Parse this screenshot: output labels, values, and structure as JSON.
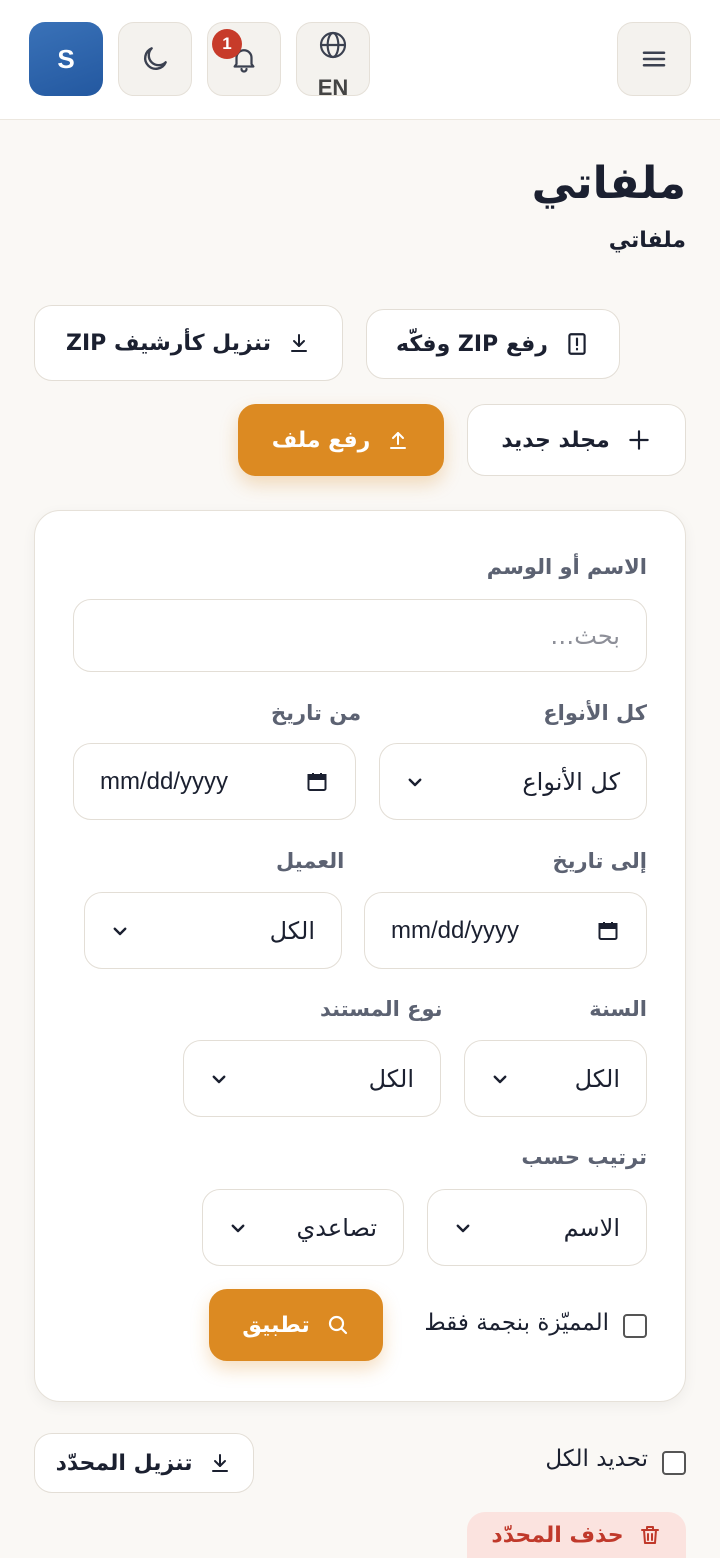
{
  "header": {
    "avatar_initial": "S",
    "notification_count": "1",
    "language_label": "EN",
    "icons": [
      "menu-icon",
      "globe-icon",
      "bell-icon",
      "moon-icon"
    ]
  },
  "page": {
    "title": "ملفاتي",
    "subtitle": "ملفاتي"
  },
  "actions": {
    "download_zip": "تنزيل كأرشيف ZIP",
    "upload_zip": "رفع ZIP وفكّه",
    "new_folder": "مجلد جديد",
    "upload_file": "رفع ملف"
  },
  "filters": {
    "search_label": "الاسم أو الوسم",
    "search_placeholder": "بحث…",
    "type_label": "كل الأنواع",
    "type_value": "كل الأنواع",
    "from_date_label": "من تاريخ",
    "from_date_value": "mm/dd/yyyy",
    "to_date_label": "إلى تاريخ",
    "to_date_value": "mm/dd/yyyy",
    "client_label": "العميل",
    "client_value": "الكل",
    "year_label": "السنة",
    "year_value": "الكل",
    "doctype_label": "نوع المستند",
    "doctype_value": "الكل",
    "sort_label": "ترتيب حسب",
    "sort_field_value": "الاسم",
    "sort_order_value": "تصاعدي",
    "starred_label": "المميّزة بنجمة فقط",
    "apply_label": "تطبيق"
  },
  "bulk": {
    "select_all_label": "تحديد الكل",
    "download_selected": "تنزيل المحدّد",
    "delete_selected": "حذف المحدّد"
  },
  "colors": {
    "accent": "#dc8a22",
    "avatar": "#2f66ad",
    "badge": "#c73b2a",
    "danger": "#c0392b"
  }
}
